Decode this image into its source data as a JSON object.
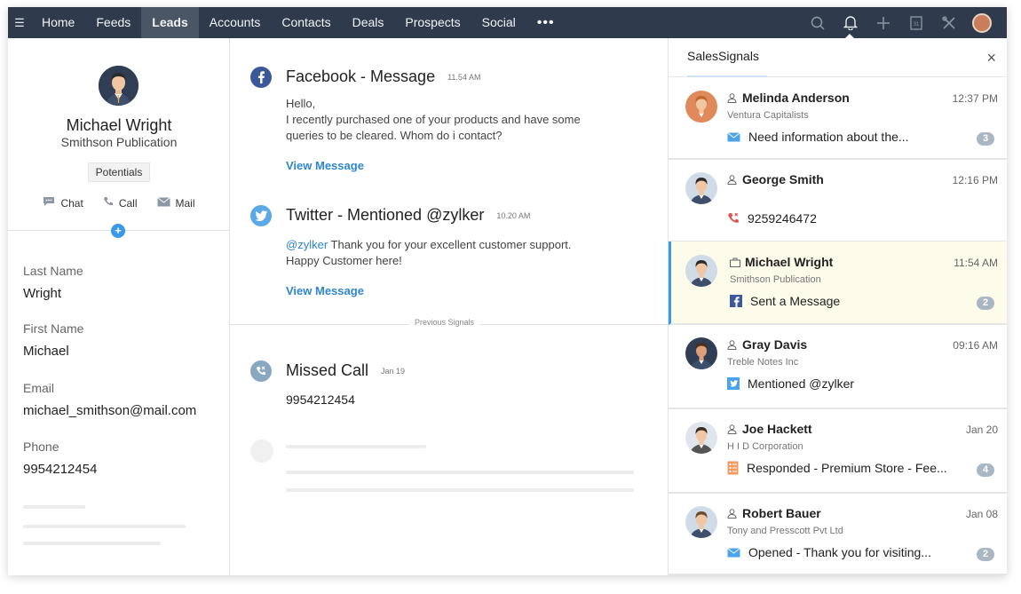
{
  "nav": {
    "menu_icon": "hamburger-icon",
    "items": [
      "Home",
      "Feeds",
      "Leads",
      "Accounts",
      "Contacts",
      "Deals",
      "Prospects",
      "Social"
    ],
    "active": "Leads",
    "more": "•••",
    "right_icons": [
      "search-icon",
      "bell-icon",
      "plus-icon",
      "calendar-icon",
      "tools-icon",
      "user-avatar"
    ]
  },
  "lead": {
    "name": "Michael Wright",
    "company": "Smithson Publication",
    "tag": "Potentials",
    "actions": {
      "chat": "Chat",
      "call": "Call",
      "mail": "Mail"
    },
    "add": "+",
    "fields": [
      {
        "label": "Last Name",
        "value": "Wright"
      },
      {
        "label": "First Name",
        "value": "Michael"
      },
      {
        "label": "Email",
        "value": "michael_smithson@mail.com"
      },
      {
        "label": "Phone",
        "value": "9954212454"
      }
    ]
  },
  "signals": [
    {
      "icon": "facebook-icon",
      "color": "#3b5998",
      "title": "Facebook - Message",
      "time": "11.54 AM",
      "body": [
        "Hello,",
        "I recently purchased one of your products and have some",
        "queries to be cleared. Whom do i contact?"
      ],
      "link": "View Message"
    },
    {
      "icon": "twitter-icon",
      "color": "#5aa9e6",
      "title": "Twitter - Mentioned @zylker",
      "time": "10.20 AM",
      "mention": "@zylker",
      "body_rest": " Thank you for your excellent customer support.",
      "body2": "Happy Customer here!",
      "link": "View Message"
    }
  ],
  "previous_label": "Previous Signals",
  "previous": {
    "icon": "missed-call-icon",
    "color": "#8aa7c2",
    "title": "Missed Call",
    "time": "Jan 19",
    "body": "9954212454"
  },
  "sales_signals": {
    "title": "SalesSignals",
    "close": "×",
    "items": [
      {
        "name": "Melinda Anderson",
        "company": "Ventura Capitalists",
        "time": "12:37 PM",
        "msg_icon": "mail-icon",
        "msg": "Need information about the...",
        "count": "3",
        "avatar_color": "#e08a5b",
        "person_icon": "person-icon"
      },
      {
        "name": "George Smith",
        "company": "",
        "time": "12:16 PM",
        "msg_icon": "missed-call-icon",
        "msg": "9259246472",
        "count": "",
        "avatar_color": "#cfdbe7",
        "person_icon": "person-icon"
      },
      {
        "name": "Michael Wright",
        "company": "Smithson Publication",
        "time": "11:54 AM",
        "msg_icon": "facebook-icon",
        "msg": "Sent a Message",
        "count": "2",
        "avatar_color": "#cfdbe7",
        "person_icon": "briefcase-icon"
      },
      {
        "name": "Gray Davis",
        "company": "Treble Notes Inc",
        "time": "09:16 AM",
        "msg_icon": "twitter-icon",
        "msg": "Mentioned @zylker",
        "count": "",
        "avatar_color": "#2f3e54",
        "person_icon": "person-icon"
      },
      {
        "name": "Joe Hackett",
        "company": "H I D Corporation",
        "time": "Jan 20",
        "msg_icon": "survey-icon",
        "msg": "Responded - Premium Store - Fee...",
        "count": "4",
        "avatar_color": "#cfdbe7",
        "person_icon": "person-icon"
      },
      {
        "name": "Robert Bauer",
        "company": "Tony and Presscott Pvt Ltd",
        "time": "Jan 08",
        "msg_icon": "mail-icon",
        "msg": "Opened - Thank you for visiting...",
        "count": "2",
        "avatar_color": "#cfdbe7",
        "person_icon": "person-icon"
      }
    ]
  }
}
